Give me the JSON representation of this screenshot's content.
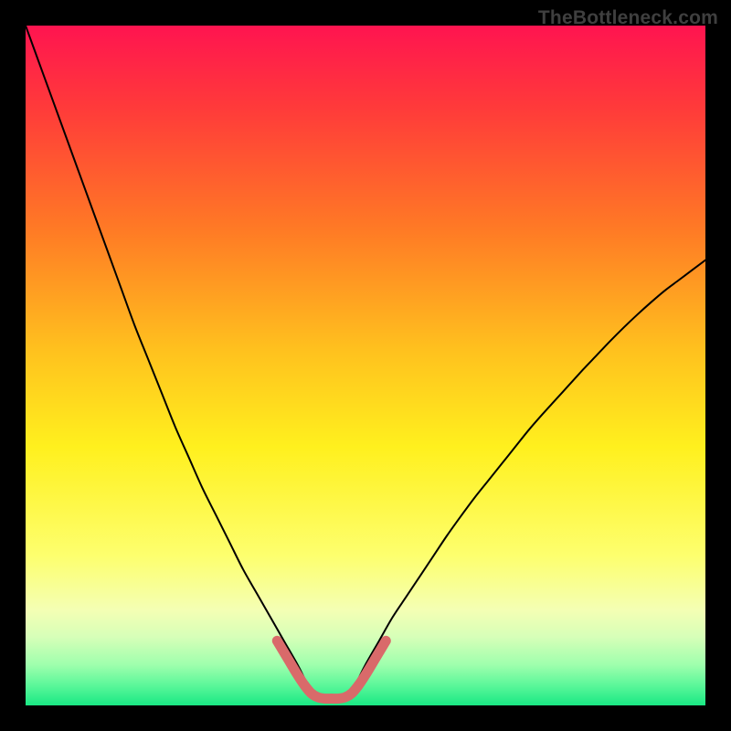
{
  "watermark": "TheBottleneck.com",
  "chart_data": {
    "type": "line",
    "title": "",
    "xlabel": "",
    "ylabel": "",
    "xlim": [
      0,
      100
    ],
    "ylim": [
      0,
      100
    ],
    "grid": false,
    "legend": {
      "visible": false
    },
    "gradient_stops": [
      {
        "offset": 0.0,
        "color": "#ff1450"
      },
      {
        "offset": 0.12,
        "color": "#ff3a3a"
      },
      {
        "offset": 0.3,
        "color": "#ff7a25"
      },
      {
        "offset": 0.48,
        "color": "#ffc21e"
      },
      {
        "offset": 0.62,
        "color": "#fff01e"
      },
      {
        "offset": 0.78,
        "color": "#fdff6e"
      },
      {
        "offset": 0.86,
        "color": "#f4ffb4"
      },
      {
        "offset": 0.9,
        "color": "#d6ffb8"
      },
      {
        "offset": 0.94,
        "color": "#9fffad"
      },
      {
        "offset": 0.97,
        "color": "#5cf79a"
      },
      {
        "offset": 1.0,
        "color": "#19e884"
      }
    ],
    "series": [
      {
        "name": "curve-left",
        "stroke": "#000000",
        "stroke_width": 2,
        "x": [
          0.0,
          2.0,
          4.0,
          6.0,
          8.0,
          10.0,
          12.0,
          14.0,
          16.0,
          18.0,
          20.0,
          22.0,
          24.0,
          26.0,
          28.0,
          30.0,
          32.0,
          34.0,
          36.0,
          38.0,
          40.0,
          41.0,
          42.0
        ],
        "y": [
          100.0,
          94.5,
          89.0,
          83.5,
          78.0,
          72.5,
          67.0,
          61.5,
          56.0,
          51.0,
          46.0,
          41.0,
          36.5,
          32.0,
          28.0,
          24.0,
          20.0,
          16.5,
          13.0,
          9.5,
          6.0,
          4.0,
          2.0
        ]
      },
      {
        "name": "curve-right",
        "stroke": "#000000",
        "stroke_width": 2,
        "x": [
          48.0,
          49.0,
          50.0,
          52.0,
          54.0,
          56.0,
          58.0,
          60.0,
          62.0,
          64.0,
          66.0,
          68.0,
          70.0,
          72.0,
          74.0,
          76.0,
          78.0,
          80.0,
          82.0,
          84.0,
          86.0,
          88.0,
          90.0,
          92.0,
          94.0,
          96.0,
          98.0,
          100.0
        ],
        "y": [
          2.0,
          4.0,
          6.0,
          9.5,
          13.0,
          16.0,
          19.0,
          22.0,
          25.0,
          27.8,
          30.5,
          33.0,
          35.5,
          38.0,
          40.5,
          42.8,
          45.0,
          47.2,
          49.4,
          51.5,
          53.6,
          55.6,
          57.5,
          59.3,
          61.0,
          62.5,
          64.0,
          65.5
        ]
      },
      {
        "name": "valley-highlight",
        "stroke": "#d96a6a",
        "stroke_width": 11,
        "x": [
          37.0,
          38.5,
          40.0,
          41.0,
          42.0,
          43.0,
          44.0,
          45.0,
          46.0,
          47.0,
          48.0,
          49.0,
          50.0,
          51.5,
          53.0
        ],
        "y": [
          9.5,
          7.0,
          4.5,
          3.0,
          1.8,
          1.2,
          1.0,
          1.0,
          1.0,
          1.2,
          1.8,
          3.0,
          4.5,
          7.0,
          9.5
        ]
      }
    ]
  }
}
